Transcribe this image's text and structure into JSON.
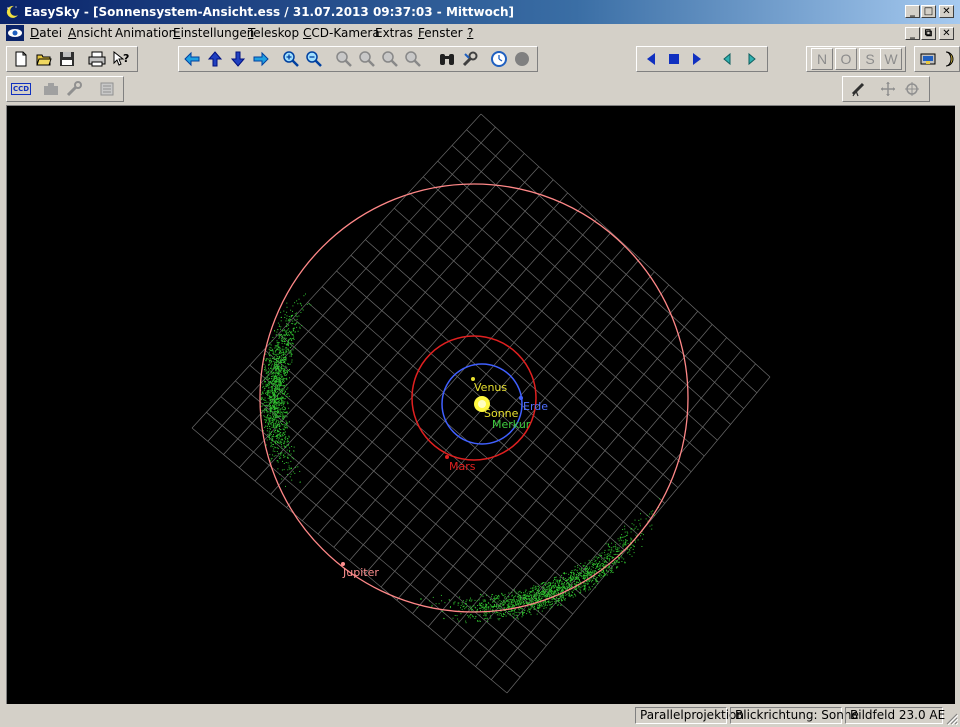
{
  "window": {
    "title": "EasySky - [Sonnensystem-Ansicht.ess / 31.07.2013 09:37:03 - Mittwoch]",
    "min_glyph": "_",
    "max_glyph": "□",
    "close_glyph": "✕",
    "restore_glyph": "⧉"
  },
  "menu": {
    "items": [
      {
        "key": "D",
        "rest": "atei"
      },
      {
        "key": "A",
        "rest": "nsicht"
      },
      {
        "key": "",
        "rest": "Animation"
      },
      {
        "key": "E",
        "rest": "instellungen"
      },
      {
        "key": "T",
        "rest": "eleskop"
      },
      {
        "key": "C",
        "rest": "CD-Kamera"
      },
      {
        "key": "",
        "rest": "Extras"
      },
      {
        "key": "F",
        "rest": "enster"
      },
      {
        "key": "?",
        "rest": ""
      }
    ]
  },
  "toolbar": {
    "file": [
      "new-file-icon",
      "open-folder-icon",
      "save-disk-icon",
      "print-icon",
      "help-pointer-icon"
    ],
    "nav_arrows": [
      "arrow-left-icon",
      "arrow-up-icon",
      "arrow-down-icon",
      "arrow-right-icon"
    ],
    "zoom": [
      "zoom-in-icon",
      "zoom-out-icon",
      "zoom-a-icon",
      "zoom-b-icon",
      "zoom-c-icon",
      "zoom-d-icon"
    ],
    "misc": [
      "binoculars-icon",
      "wrench-icon",
      "clock-icon",
      "record-icon"
    ],
    "animation": [
      "play-back-icon",
      "stop-icon",
      "play-forward-icon",
      "step-back-icon",
      "step-forward-icon"
    ],
    "compass": [
      "N",
      "O",
      "S",
      "W"
    ],
    "row2_ccd_label": "CCD"
  },
  "view": {
    "planets": {
      "sonne": "Sonne",
      "merkur": "Merkur",
      "venus": "Venus",
      "erde": "Erde",
      "mars": "Mars",
      "jupiter": "Jupiter"
    },
    "colors": {
      "background": "#000000",
      "grid": "#6a6a6a",
      "sun": "#ffff30",
      "mercury": "#40d040",
      "venus": "#e8e030",
      "earth": "#4060ff",
      "mars": "#e02020",
      "jupiter": "#ff9090",
      "asteroids": "#30c030"
    }
  },
  "status": {
    "projection": "Parallelprojektion",
    "view_direction": "Blickrichtung: Sonne",
    "field": "Bildfeld 23.0 AE"
  }
}
